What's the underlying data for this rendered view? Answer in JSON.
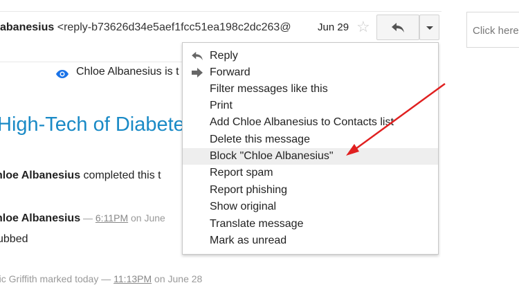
{
  "header": {
    "sender_name": "abanesius",
    "sender_address": "<reply-b73626d34e5aef1fcc51ea198c2dc263@",
    "date": "Jun 29"
  },
  "side": {
    "click_here": "Click here"
  },
  "tracking": {
    "text": "Chloe Albanesius is t"
  },
  "message": {
    "title": "High-Tech of Diabete",
    "line1_name": "hloe Albanesius",
    "line1_rest": " completed this t",
    "line2_name": "hloe Albanesius",
    "line2_dash": " — ",
    "line2_time": "6:11PM",
    "line2_on": " on June",
    "bubbed": "ubbed",
    "line3_prefix": "ric Griffith marked today — ",
    "line3_time": "11:13PM",
    "line3_suffix": " on June 28"
  },
  "menu": {
    "items": [
      {
        "label": "Reply",
        "icon": "reply-icon"
      },
      {
        "label": "Forward",
        "icon": "forward-icon"
      },
      {
        "label": "Filter messages like this"
      },
      {
        "label": "Print"
      },
      {
        "label": "Add Chloe Albanesius to Contacts list"
      },
      {
        "label": "Delete this message"
      },
      {
        "label": "Block \"Chloe Albanesius\"",
        "highlighted": true
      },
      {
        "label": "Report spam"
      },
      {
        "label": "Report phishing"
      },
      {
        "label": "Show original"
      },
      {
        "label": "Translate message"
      },
      {
        "label": "Mark as unread"
      }
    ]
  },
  "colors": {
    "link_blue": "#1a8ac6",
    "annotation_arrow": "#e02020",
    "highlight": "#eeeeee"
  }
}
